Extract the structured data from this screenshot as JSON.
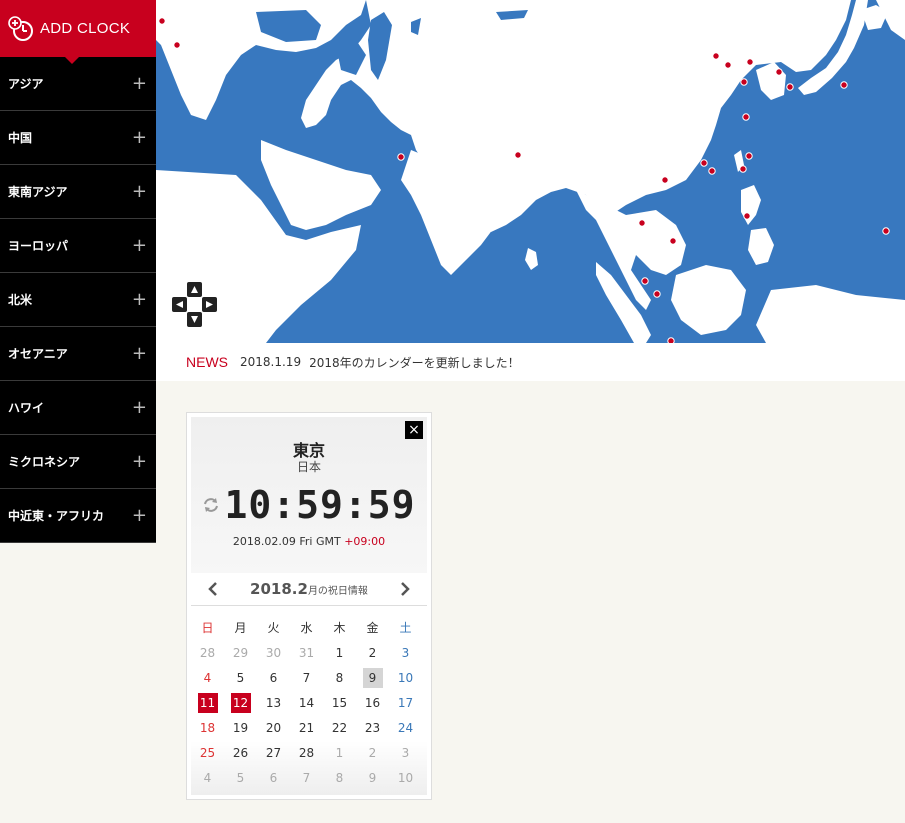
{
  "sidebar": {
    "add_clock_label": "ADD CLOCK",
    "items": [
      {
        "label": "アジア"
      },
      {
        "label": "中国"
      },
      {
        "label": "東南アジア"
      },
      {
        "label": "ヨーロッパ"
      },
      {
        "label": "北米"
      },
      {
        "label": "オセアニア"
      },
      {
        "label": "ハワイ"
      },
      {
        "label": "ミクロネシア"
      },
      {
        "label": "中近東・アフリカ"
      }
    ],
    "expand_symbol": "+"
  },
  "map": {
    "ocean_color": "#3878bf",
    "land_color": "#ffffff",
    "marker_color": "#c8001e"
  },
  "news": {
    "label": "NEWS",
    "date": "2018.1.19",
    "text": "2018年のカレンダーを更新しました！"
  },
  "clock": {
    "close_symbol": "×",
    "city": "東京",
    "country": "日本",
    "time": "10:59:59",
    "date_text": "2018.02.09 Fri GMT ",
    "offset": "+09:00"
  },
  "calendar": {
    "title": "2018.2",
    "subtitle": "月の祝日情報",
    "weekdays": [
      "日",
      "月",
      "火",
      "水",
      "木",
      "金",
      "土"
    ],
    "weeks": [
      [
        "28",
        "29",
        "30",
        "31",
        "1",
        "2",
        "3"
      ],
      [
        "4",
        "5",
        "6",
        "7",
        "8",
        "9",
        "10"
      ],
      [
        "11",
        "12",
        "13",
        "14",
        "15",
        "16",
        "17"
      ],
      [
        "18",
        "19",
        "20",
        "21",
        "22",
        "23",
        "24"
      ],
      [
        "25",
        "26",
        "27",
        "28",
        "1",
        "2",
        "3"
      ],
      [
        "4",
        "5",
        "6",
        "7",
        "8",
        "9",
        "10"
      ]
    ],
    "holiday_color": "#c8001e"
  }
}
